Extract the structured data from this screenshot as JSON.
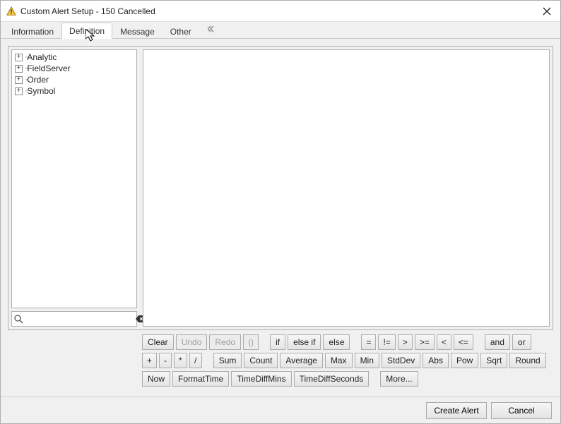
{
  "window": {
    "title": "Custom Alert Setup - 150 Cancelled"
  },
  "tabs": {
    "information": "Information",
    "definition": "Definition",
    "message": "Message",
    "other": "Other"
  },
  "tree": {
    "items": [
      {
        "label": "Analytic"
      },
      {
        "label": "FieldServer"
      },
      {
        "label": "Order"
      },
      {
        "label": "Symbol"
      }
    ]
  },
  "search": {
    "placeholder": ""
  },
  "toolbar": {
    "row1": {
      "clear": "Clear",
      "undo": "Undo",
      "redo": "Redo",
      "paren": "()",
      "if": "if",
      "elseif": "else if",
      "else": "else",
      "eq": "=",
      "neq": "!=",
      "gt": ">",
      "gte": ">=",
      "lt": "<",
      "lte": "<=",
      "and": "and",
      "or": "or"
    },
    "row2": {
      "plus": "+",
      "minus": "-",
      "mul": "*",
      "div": "/",
      "sum": "Sum",
      "count": "Count",
      "average": "Average",
      "max": "Max",
      "min": "Min",
      "stddev": "StdDev",
      "abs": "Abs",
      "pow": "Pow",
      "sqrt": "Sqrt",
      "round": "Round"
    },
    "row3": {
      "now": "Now",
      "formattime": "FormatTime",
      "timediffmins": "TimeDiffMins",
      "timediffseconds": "TimeDiffSeconds",
      "more": "More..."
    }
  },
  "footer": {
    "create": "Create Alert",
    "cancel": "Cancel"
  }
}
